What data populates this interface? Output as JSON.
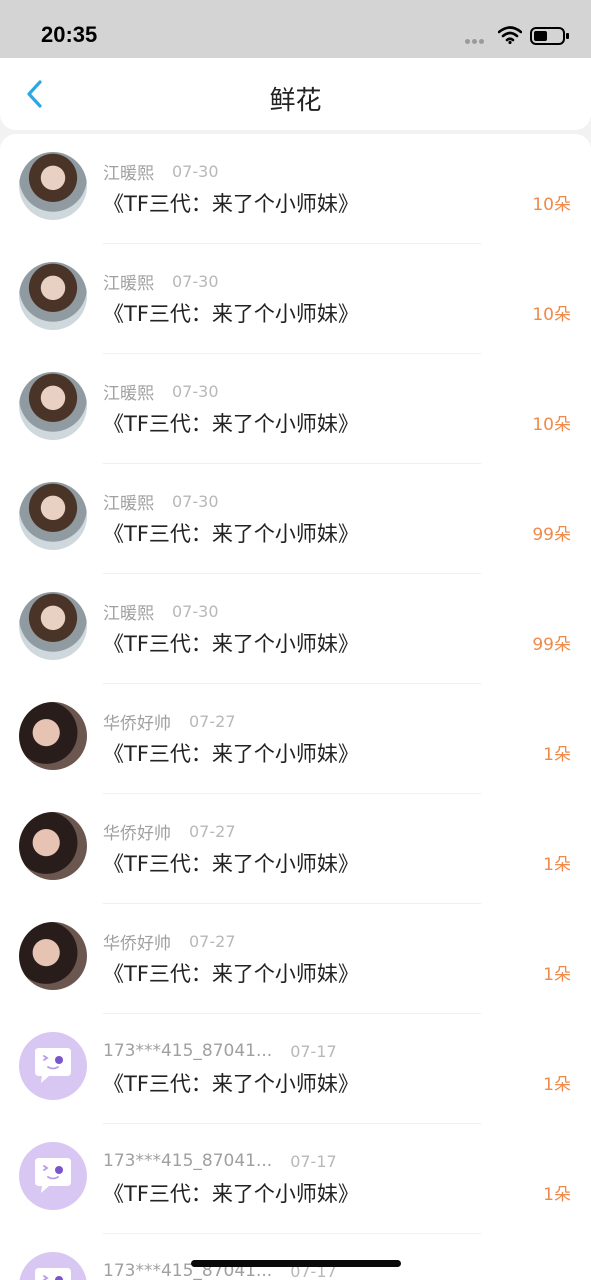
{
  "status_bar": {
    "time": "20:35"
  },
  "nav": {
    "title": "鲜花"
  },
  "items": [
    {
      "name": "江暖熙",
      "date": "07-30",
      "title": "《TF三代：来了个小师妹》",
      "amount": "10朵",
      "avatar": "photo-a"
    },
    {
      "name": "江暖熙",
      "date": "07-30",
      "title": "《TF三代：来了个小师妹》",
      "amount": "10朵",
      "avatar": "photo-a"
    },
    {
      "name": "江暖熙",
      "date": "07-30",
      "title": "《TF三代：来了个小师妹》",
      "amount": "10朵",
      "avatar": "photo-a"
    },
    {
      "name": "江暖熙",
      "date": "07-30",
      "title": "《TF三代：来了个小师妹》",
      "amount": "99朵",
      "avatar": "photo-a"
    },
    {
      "name": "江暖熙",
      "date": "07-30",
      "title": "《TF三代：来了个小师妹》",
      "amount": "99朵",
      "avatar": "photo-a"
    },
    {
      "name": "华侨好帅",
      "date": "07-27",
      "title": "《TF三代：来了个小师妹》",
      "amount": "1朵",
      "avatar": "photo-b"
    },
    {
      "name": "华侨好帅",
      "date": "07-27",
      "title": "《TF三代：来了个小师妹》",
      "amount": "1朵",
      "avatar": "photo-b"
    },
    {
      "name": "华侨好帅",
      "date": "07-27",
      "title": "《TF三代：来了个小师妹》",
      "amount": "1朵",
      "avatar": "photo-b"
    },
    {
      "name": "173***415_87041...",
      "date": "07-17",
      "title": "《TF三代：来了个小师妹》",
      "amount": "1朵",
      "avatar": "default"
    },
    {
      "name": "173***415_87041...",
      "date": "07-17",
      "title": "《TF三代：来了个小师妹》",
      "amount": "1朵",
      "avatar": "default"
    },
    {
      "name": "173***415_87041...",
      "date": "07-17",
      "title": "",
      "amount": "",
      "avatar": "default"
    }
  ],
  "icons": {
    "back": "chevron-left-icon",
    "wifi": "wifi-icon",
    "battery": "battery-icon",
    "default_avatar": "chat-bubble-icon"
  },
  "colors": {
    "accent": "#2ba7e6",
    "amount": "#ef8a4a",
    "default_avatar_bg": "#d8c7f3"
  }
}
